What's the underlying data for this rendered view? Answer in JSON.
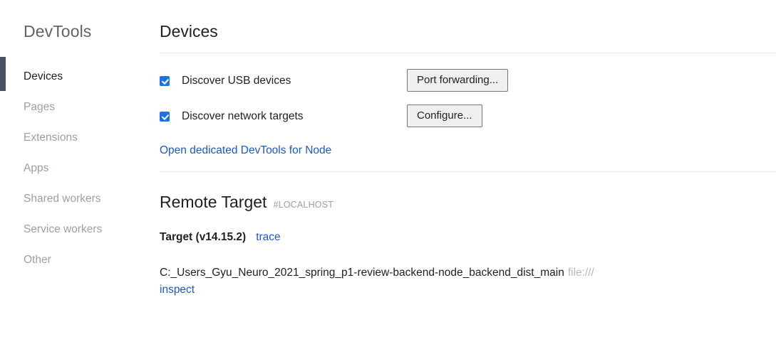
{
  "sidebar": {
    "title": "DevTools",
    "items": [
      {
        "label": "Devices",
        "selected": true
      },
      {
        "label": "Pages",
        "selected": false
      },
      {
        "label": "Extensions",
        "selected": false
      },
      {
        "label": "Apps",
        "selected": false
      },
      {
        "label": "Shared workers",
        "selected": false
      },
      {
        "label": "Service workers",
        "selected": false
      },
      {
        "label": "Other",
        "selected": false
      }
    ]
  },
  "main": {
    "page_title": "Devices",
    "discover_usb": {
      "label": "Discover USB devices",
      "checked": true,
      "button_label": "Port forwarding..."
    },
    "discover_network": {
      "label": "Discover network targets",
      "checked": true,
      "button_label": "Configure..."
    },
    "node_link_label": "Open dedicated DevTools for Node",
    "remote_target": {
      "title": "Remote Target",
      "host": "#LOCALHOST",
      "target_name": "Target (v14.15.2)",
      "trace_label": "trace",
      "path": "C:_Users_Gyu_Neuro_2021_spring_p1-review-backend-node_backend_dist_main",
      "url": "file:///",
      "inspect_label": "inspect"
    }
  },
  "colors": {
    "accent_blue": "#1a73e8",
    "link_blue": "#1a56d6",
    "active_bar": "#4a5260",
    "text_primary": "#202124",
    "text_muted": "#9aa0a6",
    "divider": "#e8eaed",
    "button_bg": "#efefef",
    "button_border": "#767676"
  }
}
